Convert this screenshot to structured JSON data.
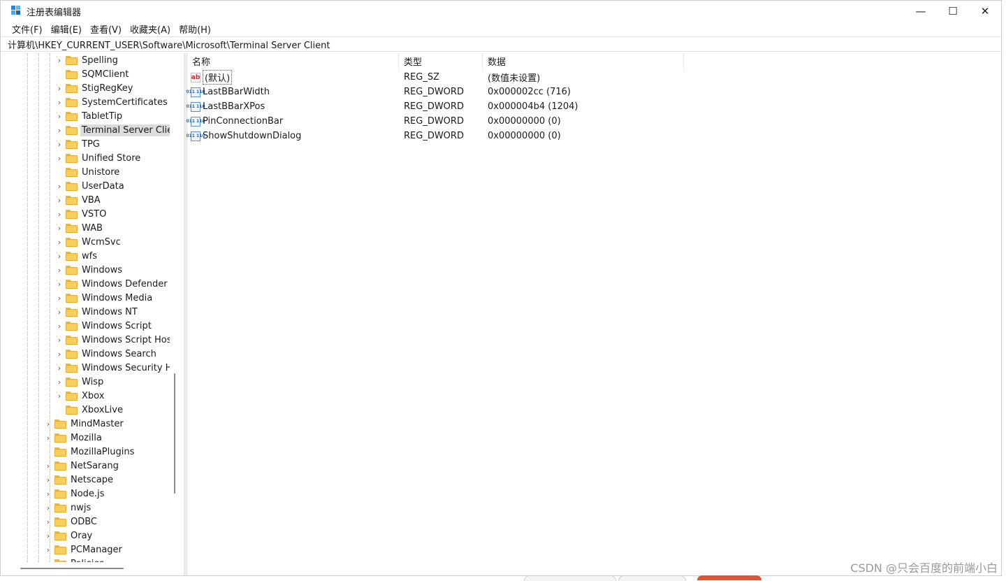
{
  "window": {
    "title": "注册表编辑器",
    "controls": {
      "minimize": "—",
      "maximize": "☐",
      "close": "✕"
    }
  },
  "menu": [
    "文件(F)",
    "编辑(E)",
    "查看(V)",
    "收藏夹(A)",
    "帮助(H)"
  ],
  "address": "计算机\\HKEY_CURRENT_USER\\Software\\Microsoft\\Terminal Server Client",
  "tree": {
    "level2": [
      "Spelling",
      "SQMClient",
      "StigRegKey",
      "SystemCertificates",
      "TabletTip",
      "Terminal Server Client",
      "TPG",
      "Unified Store",
      "Unistore",
      "UserData",
      "VBA",
      "VSTO",
      "WAB",
      "WcmSvc",
      "wfs",
      "Windows",
      "Windows Defender Se",
      "Windows Media",
      "Windows NT",
      "Windows Script",
      "Windows Script Host",
      "Windows Search",
      "Windows Security Hea",
      "Wisp",
      "Xbox",
      "XboxLive"
    ],
    "level1": [
      "MindMaster",
      "Mozilla",
      "MozillaPlugins",
      "NetSarang",
      "Netscape",
      "Node.js",
      "nwjs",
      "ODBC",
      "Oray",
      "PCManager",
      "Policies"
    ],
    "selected": "Terminal Server Client",
    "expander_glyph": "›"
  },
  "columns": {
    "name": "名称",
    "type": "类型",
    "data": "数据"
  },
  "values": [
    {
      "icon": "string-value-icon",
      "icon_text": "ab",
      "name": "(默认)",
      "type": "REG_SZ",
      "data": "(数值未设置)"
    },
    {
      "icon": "binary-value-icon",
      "icon_text": "011 110",
      "name": "LastBBarWidth",
      "type": "REG_DWORD",
      "data": "0x000002cc (716)"
    },
    {
      "icon": "binary-value-icon",
      "icon_text": "011 110",
      "name": "LastBBarXPos",
      "type": "REG_DWORD",
      "data": "0x000004b4 (1204)"
    },
    {
      "icon": "binary-value-icon",
      "icon_text": "011 110",
      "name": "PinConnectionBar",
      "type": "REG_DWORD",
      "data": "0x00000000 (0)"
    },
    {
      "icon": "binary-value-icon",
      "icon_text": "011 110",
      "name": "ShowShutdownDialog",
      "type": "REG_DWORD",
      "data": "0x00000000 (0)"
    }
  ],
  "watermark": "CSDN @只会百度的前端小白",
  "colors": {
    "folder": "#f7cf5a",
    "selection": "#dcdcdc",
    "accent": "#1e88e5"
  }
}
